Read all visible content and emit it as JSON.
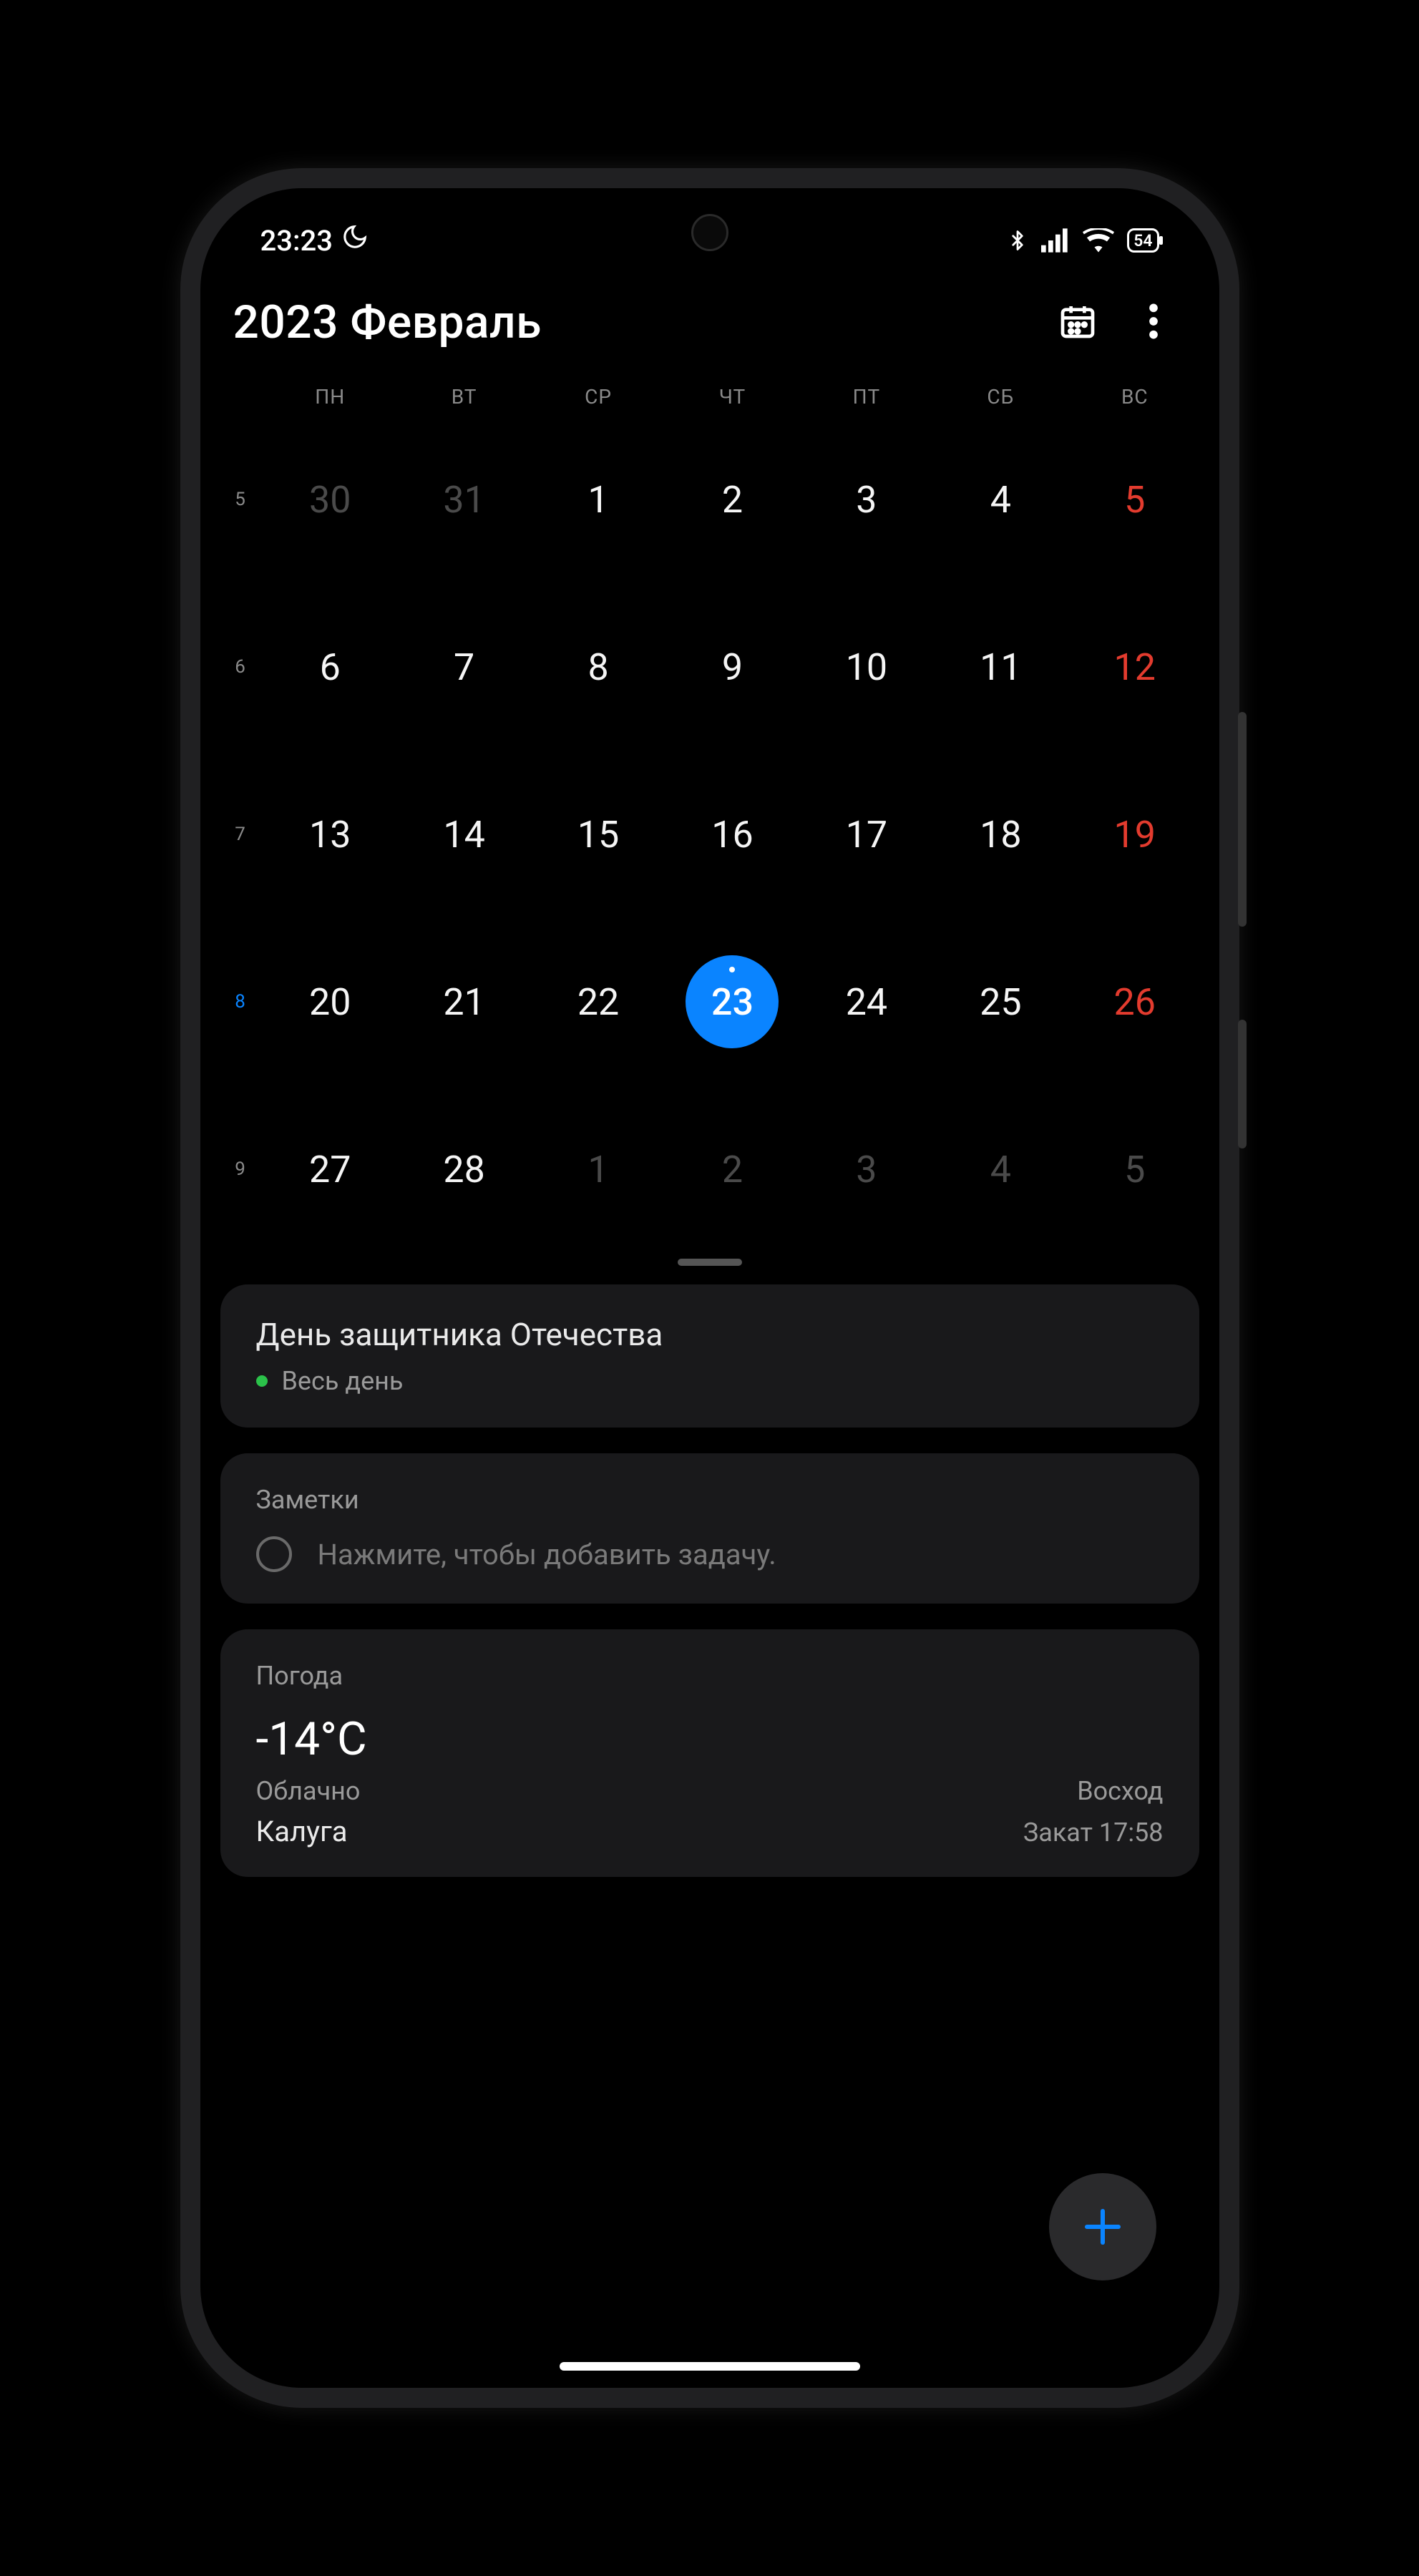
{
  "status": {
    "time": "23:23",
    "battery": "54"
  },
  "header": {
    "title": "2023 Февраль"
  },
  "weekdays": [
    "ПН",
    "ВТ",
    "СР",
    "ЧТ",
    "ПТ",
    "СБ",
    "ВС"
  ],
  "weeks": [
    {
      "no": "5",
      "current": false,
      "days": [
        {
          "d": "30",
          "outside": true
        },
        {
          "d": "31",
          "outside": true
        },
        {
          "d": "1"
        },
        {
          "d": "2"
        },
        {
          "d": "3"
        },
        {
          "d": "4"
        },
        {
          "d": "5",
          "sunday": true
        }
      ]
    },
    {
      "no": "6",
      "current": false,
      "days": [
        {
          "d": "6"
        },
        {
          "d": "7"
        },
        {
          "d": "8"
        },
        {
          "d": "9"
        },
        {
          "d": "10"
        },
        {
          "d": "11"
        },
        {
          "d": "12",
          "sunday": true
        }
      ]
    },
    {
      "no": "7",
      "current": false,
      "days": [
        {
          "d": "13"
        },
        {
          "d": "14"
        },
        {
          "d": "15"
        },
        {
          "d": "16"
        },
        {
          "d": "17"
        },
        {
          "d": "18"
        },
        {
          "d": "19",
          "sunday": true
        }
      ]
    },
    {
      "no": "8",
      "current": true,
      "days": [
        {
          "d": "20"
        },
        {
          "d": "21"
        },
        {
          "d": "22"
        },
        {
          "d": "23",
          "selected": true,
          "event": true
        },
        {
          "d": "24"
        },
        {
          "d": "25"
        },
        {
          "d": "26",
          "sunday": true
        }
      ]
    },
    {
      "no": "9",
      "current": false,
      "days": [
        {
          "d": "27"
        },
        {
          "d": "28"
        },
        {
          "d": "1",
          "outside": true
        },
        {
          "d": "2",
          "outside": true
        },
        {
          "d": "3",
          "outside": true
        },
        {
          "d": "4",
          "outside": true
        },
        {
          "d": "5",
          "outside": true
        }
      ]
    }
  ],
  "event": {
    "title": "День защитника Отечества",
    "time": "Весь день"
  },
  "notes": {
    "heading": "Заметки",
    "placeholder": "Нажмите, чтобы добавить задачу."
  },
  "weather": {
    "heading": "Погода",
    "temp": "-14°C",
    "condition": "Облачно",
    "sunrise": "Восход",
    "city": "Калуга",
    "sunset": "Закат 17:58"
  }
}
